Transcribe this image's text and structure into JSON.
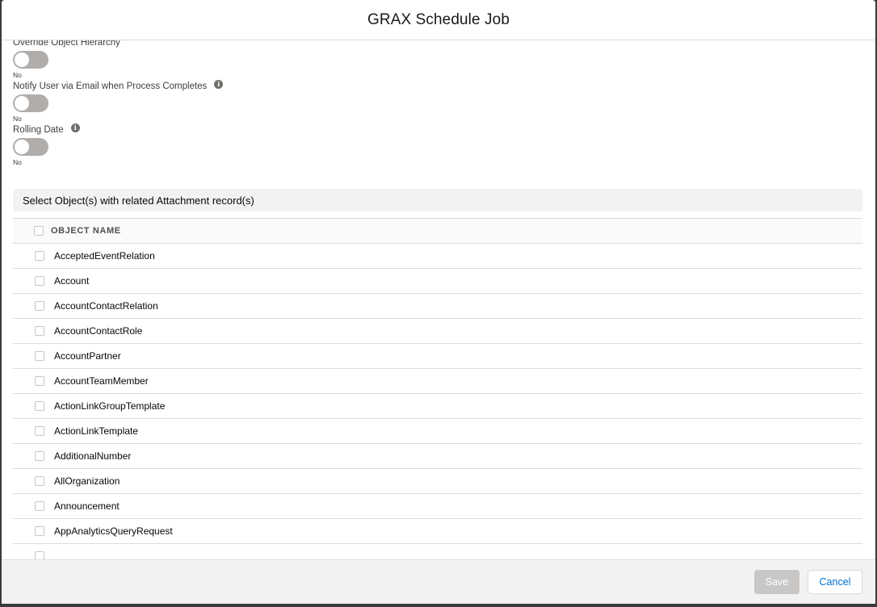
{
  "modal": {
    "title": "GRAX Schedule Job"
  },
  "fields": [
    {
      "label": "Override Object Hierarchy",
      "value": "No",
      "has_info": false
    },
    {
      "label": "Notify User via Email when Process Completes",
      "value": "No",
      "has_info": true
    },
    {
      "label": "Rolling Date",
      "value": "No",
      "has_info": true
    }
  ],
  "section": {
    "title": "Select Object(s) with related Attachment record(s)"
  },
  "table": {
    "column_header": "OBJECT NAME",
    "rows": [
      "AcceptedEventRelation",
      "Account",
      "AccountContactRelation",
      "AccountContactRole",
      "AccountPartner",
      "AccountTeamMember",
      "ActionLinkGroupTemplate",
      "ActionLinkTemplate",
      "AdditionalNumber",
      "AllOrganization",
      "Announcement",
      "AppAnalyticsQueryRequest"
    ]
  },
  "footer": {
    "save_label": "Save",
    "cancel_label": "Cancel"
  },
  "colors": {
    "toggle_off": "#b0adab",
    "link": "#0070d2",
    "disabled_button": "#c9c7c5"
  }
}
